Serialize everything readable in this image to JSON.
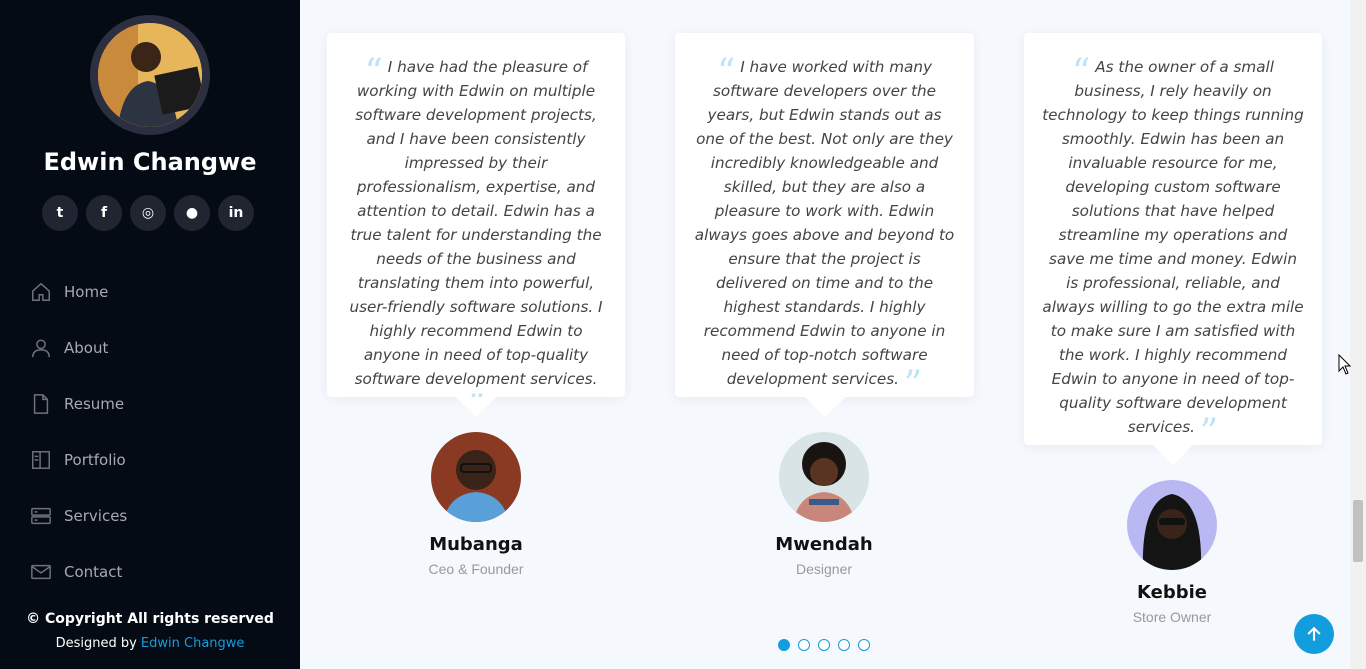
{
  "sidebar": {
    "name": "Edwin Changwe",
    "social": [
      {
        "icon": "twitter-icon",
        "glyph": "t"
      },
      {
        "icon": "facebook-icon",
        "glyph": "f"
      },
      {
        "icon": "instagram-icon",
        "glyph": "◎"
      },
      {
        "icon": "github-icon",
        "glyph": "●"
      },
      {
        "icon": "linkedin-icon",
        "glyph": "in"
      }
    ],
    "nav": [
      {
        "label": "Home",
        "icon": "house-icon"
      },
      {
        "label": "About",
        "icon": "person-icon"
      },
      {
        "label": "Resume",
        "icon": "file-icon"
      },
      {
        "label": "Portfolio",
        "icon": "book-icon"
      },
      {
        "label": "Services",
        "icon": "server-icon"
      },
      {
        "label": "Contact",
        "icon": "envelope-icon"
      }
    ],
    "copyright": "© Copyright All rights reserved",
    "designed_by_prefix": "Designed by",
    "designed_by_name": "Edwin Changwe"
  },
  "testimonials": [
    {
      "quote": "I have had the pleasure of working with Edwin on multiple software development projects, and I have been consistently impressed by their professionalism, expertise, and attention to detail. Edwin has a true talent for understanding the needs of the business and translating them into powerful, user-friendly software solutions. I highly recommend Edwin to anyone in need of top-quality software development services.",
      "name": "Mubanga",
      "role": "Ceo & Founder"
    },
    {
      "quote": "I have worked with many software developers over the years, but Edwin stands out as one of the best. Not only are they incredibly knowledgeable and skilled, but they are also a pleasure to work with. Edwin always goes above and beyond to ensure that the project is delivered on time and to the highest standards. I highly recommend Edwin to anyone in need of top-notch software development services.",
      "name": "Mwendah",
      "role": "Designer"
    },
    {
      "quote": "As the owner of a small business, I rely heavily on technology to keep things running smoothly. Edwin has been an invaluable resource for me, developing custom software solutions that have helped streamline my operations and save me time and money. Edwin is professional, reliable, and always willing to go the extra mile to make sure I am satisfied with the work. I highly recommend Edwin to anyone in need of top-quality software development services.",
      "name": "Kebbie",
      "role": "Store Owner"
    }
  ],
  "pagination": {
    "count": 5,
    "active": 0
  },
  "colors": {
    "accent": "#149ddd",
    "sidebar_bg": "#040b14",
    "main_bg": "#f5f8fd"
  },
  "back_to_top_icon": "arrow-up-icon"
}
